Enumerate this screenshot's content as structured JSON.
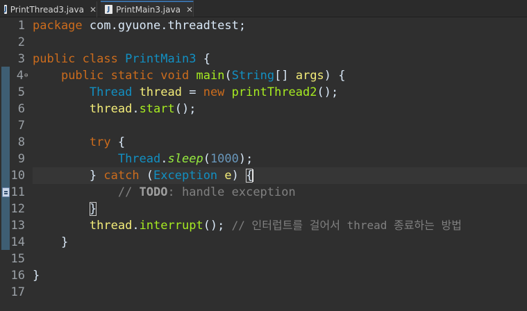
{
  "tabs": [
    {
      "label": "PrintThread3.java",
      "icon": "java-file-icon",
      "close": "✕",
      "active": false
    },
    {
      "label": "PrintMain3.java",
      "icon": "java-file-icon",
      "close": "✕",
      "active": true
    }
  ],
  "editor": {
    "line_numbers": [
      "1",
      "2",
      "3",
      "4",
      "5",
      "6",
      "7",
      "8",
      "9",
      "10",
      "11",
      "12",
      "13",
      "14",
      "15",
      "16",
      "17"
    ],
    "current_line": "10",
    "fold_marker": "⊖",
    "task_marker_line": "11",
    "lines": {
      "l1": {
        "kw": "package",
        "rest": " com.gyuone.threadtest;"
      },
      "l3": {
        "kw1": "public",
        "kw2": "class",
        "cls": "PrintMain3",
        "brace": " {"
      },
      "l4": {
        "kw1": "public",
        "kw2": "static",
        "kw3": "void",
        "fn": "main",
        "p1": "(",
        "ty": "String",
        "p2": "[] ",
        "var": "args",
        "p3": ") {"
      },
      "l5": {
        "ty": "Thread",
        "var": "thread",
        "eq": " = ",
        "kw": "new",
        "fn": "printThread2",
        "end": "();"
      },
      "l6": {
        "var": "thread",
        "dot": ".",
        "fn": "start",
        "end": "();"
      },
      "l8": {
        "kw": "try",
        "brace": " {"
      },
      "l9": {
        "ty": "Thread",
        "dot": ".",
        "stat": "sleep",
        "p1": "(",
        "num": "1000",
        "p2": ");"
      },
      "l10": {
        "b1": "} ",
        "kw": "catch",
        "p1": " (",
        "ty": "Exception",
        "sp": " ",
        "var": "e",
        "p2": ") ",
        "brace": "{"
      },
      "l11": {
        "slashes": "// ",
        "todo": "TODO",
        "rest": ": handle exception"
      },
      "l12": {
        "brace": "}"
      },
      "l13": {
        "var": "thread",
        "dot": ".",
        "fn": "interrupt",
        "end": "(); ",
        "comment": "// 인터럽트를 걸어서 thread 종료하는 방법"
      },
      "l14": {
        "brace": "}"
      },
      "l16": {
        "brace": "}"
      }
    }
  },
  "colors": {
    "background": "#2f2f2f",
    "keyword": "#cc6c1d",
    "type": "#1290c3",
    "method": "#a7ec21",
    "variable": "#f3ec79",
    "comment": "#808080",
    "number": "#6897bb",
    "change_bar": "#3e5e73"
  }
}
